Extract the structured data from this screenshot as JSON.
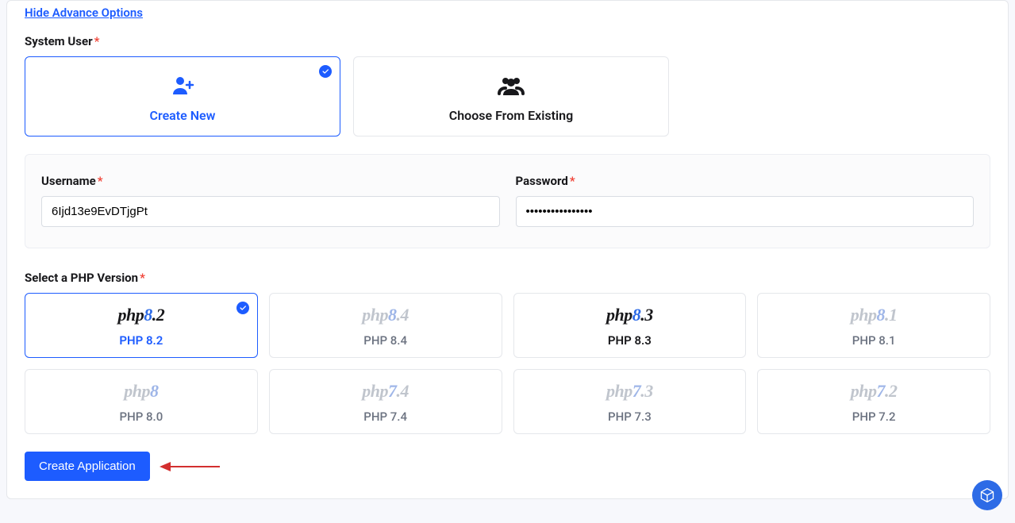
{
  "advance_link": "Hide Advance Options",
  "system_user": {
    "label": "System User",
    "options": [
      {
        "label": "Create New",
        "selected": true
      },
      {
        "label": "Choose From Existing",
        "selected": false
      }
    ]
  },
  "credentials": {
    "username_label": "Username",
    "username_value": "6Ijd13e9EvDTjgPt",
    "password_label": "Password",
    "password_value": "••••••••••••••••"
  },
  "php": {
    "label": "Select a PHP Version",
    "versions": [
      {
        "logo_prefix": "php",
        "logo_major": "8",
        "logo_minor": ".2",
        "caption": "PHP 8.2",
        "state": "selected"
      },
      {
        "logo_prefix": "php",
        "logo_major": "8",
        "logo_minor": ".4",
        "caption": "PHP 8.4",
        "state": "dim"
      },
      {
        "logo_prefix": "php",
        "logo_major": "8",
        "logo_minor": ".3",
        "caption": "PHP 8.3",
        "state": "highlight"
      },
      {
        "logo_prefix": "php",
        "logo_major": "8",
        "logo_minor": ".1",
        "caption": "PHP 8.1",
        "state": "dim"
      },
      {
        "logo_prefix": "php",
        "logo_major": "8",
        "logo_minor": "",
        "caption": "PHP 8.0",
        "state": "dim"
      },
      {
        "logo_prefix": "php",
        "logo_major": "7",
        "logo_minor": ".4",
        "caption": "PHP 7.4",
        "state": "dim"
      },
      {
        "logo_prefix": "php",
        "logo_major": "7",
        "logo_minor": ".3",
        "caption": "PHP 7.3",
        "state": "dim"
      },
      {
        "logo_prefix": "php",
        "logo_major": "7",
        "logo_minor": ".2",
        "caption": "PHP 7.2",
        "state": "dim"
      }
    ]
  },
  "actions": {
    "create_label": "Create Application"
  },
  "colors": {
    "accent": "#1d5cff",
    "arrow": "#d32f2f"
  }
}
